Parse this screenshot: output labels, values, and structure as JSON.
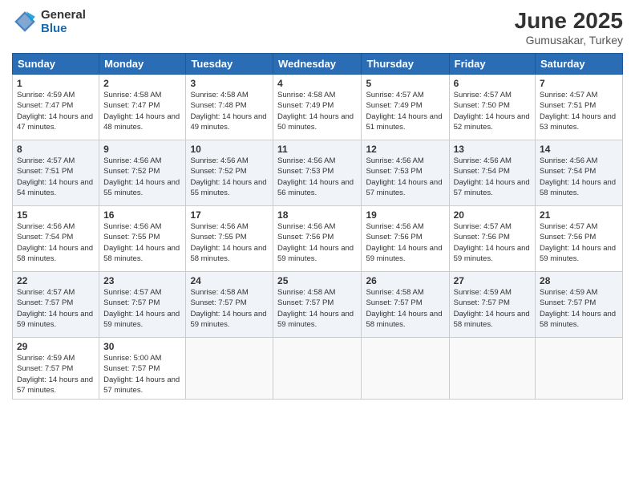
{
  "header": {
    "logo_line1": "General",
    "logo_line2": "Blue",
    "title": "June 2025",
    "location": "Gumusakar, Turkey"
  },
  "weekdays": [
    "Sunday",
    "Monday",
    "Tuesday",
    "Wednesday",
    "Thursday",
    "Friday",
    "Saturday"
  ],
  "weeks": [
    [
      {
        "day": "1",
        "sunrise": "4:59 AM",
        "sunset": "7:47 PM",
        "daylight": "14 hours and 47 minutes."
      },
      {
        "day": "2",
        "sunrise": "4:58 AM",
        "sunset": "7:47 PM",
        "daylight": "14 hours and 48 minutes."
      },
      {
        "day": "3",
        "sunrise": "4:58 AM",
        "sunset": "7:48 PM",
        "daylight": "14 hours and 49 minutes."
      },
      {
        "day": "4",
        "sunrise": "4:58 AM",
        "sunset": "7:49 PM",
        "daylight": "14 hours and 50 minutes."
      },
      {
        "day": "5",
        "sunrise": "4:57 AM",
        "sunset": "7:49 PM",
        "daylight": "14 hours and 51 minutes."
      },
      {
        "day": "6",
        "sunrise": "4:57 AM",
        "sunset": "7:50 PM",
        "daylight": "14 hours and 52 minutes."
      },
      {
        "day": "7",
        "sunrise": "4:57 AM",
        "sunset": "7:51 PM",
        "daylight": "14 hours and 53 minutes."
      }
    ],
    [
      {
        "day": "8",
        "sunrise": "4:57 AM",
        "sunset": "7:51 PM",
        "daylight": "14 hours and 54 minutes."
      },
      {
        "day": "9",
        "sunrise": "4:56 AM",
        "sunset": "7:52 PM",
        "daylight": "14 hours and 55 minutes."
      },
      {
        "day": "10",
        "sunrise": "4:56 AM",
        "sunset": "7:52 PM",
        "daylight": "14 hours and 55 minutes."
      },
      {
        "day": "11",
        "sunrise": "4:56 AM",
        "sunset": "7:53 PM",
        "daylight": "14 hours and 56 minutes."
      },
      {
        "day": "12",
        "sunrise": "4:56 AM",
        "sunset": "7:53 PM",
        "daylight": "14 hours and 57 minutes."
      },
      {
        "day": "13",
        "sunrise": "4:56 AM",
        "sunset": "7:54 PM",
        "daylight": "14 hours and 57 minutes."
      },
      {
        "day": "14",
        "sunrise": "4:56 AM",
        "sunset": "7:54 PM",
        "daylight": "14 hours and 58 minutes."
      }
    ],
    [
      {
        "day": "15",
        "sunrise": "4:56 AM",
        "sunset": "7:54 PM",
        "daylight": "14 hours and 58 minutes."
      },
      {
        "day": "16",
        "sunrise": "4:56 AM",
        "sunset": "7:55 PM",
        "daylight": "14 hours and 58 minutes."
      },
      {
        "day": "17",
        "sunrise": "4:56 AM",
        "sunset": "7:55 PM",
        "daylight": "14 hours and 58 minutes."
      },
      {
        "day": "18",
        "sunrise": "4:56 AM",
        "sunset": "7:56 PM",
        "daylight": "14 hours and 59 minutes."
      },
      {
        "day": "19",
        "sunrise": "4:56 AM",
        "sunset": "7:56 PM",
        "daylight": "14 hours and 59 minutes."
      },
      {
        "day": "20",
        "sunrise": "4:57 AM",
        "sunset": "7:56 PM",
        "daylight": "14 hours and 59 minutes."
      },
      {
        "day": "21",
        "sunrise": "4:57 AM",
        "sunset": "7:56 PM",
        "daylight": "14 hours and 59 minutes."
      }
    ],
    [
      {
        "day": "22",
        "sunrise": "4:57 AM",
        "sunset": "7:57 PM",
        "daylight": "14 hours and 59 minutes."
      },
      {
        "day": "23",
        "sunrise": "4:57 AM",
        "sunset": "7:57 PM",
        "daylight": "14 hours and 59 minutes."
      },
      {
        "day": "24",
        "sunrise": "4:58 AM",
        "sunset": "7:57 PM",
        "daylight": "14 hours and 59 minutes."
      },
      {
        "day": "25",
        "sunrise": "4:58 AM",
        "sunset": "7:57 PM",
        "daylight": "14 hours and 59 minutes."
      },
      {
        "day": "26",
        "sunrise": "4:58 AM",
        "sunset": "7:57 PM",
        "daylight": "14 hours and 58 minutes."
      },
      {
        "day": "27",
        "sunrise": "4:59 AM",
        "sunset": "7:57 PM",
        "daylight": "14 hours and 58 minutes."
      },
      {
        "day": "28",
        "sunrise": "4:59 AM",
        "sunset": "7:57 PM",
        "daylight": "14 hours and 58 minutes."
      }
    ],
    [
      {
        "day": "29",
        "sunrise": "4:59 AM",
        "sunset": "7:57 PM",
        "daylight": "14 hours and 57 minutes."
      },
      {
        "day": "30",
        "sunrise": "5:00 AM",
        "sunset": "7:57 PM",
        "daylight": "14 hours and 57 minutes."
      },
      null,
      null,
      null,
      null,
      null
    ]
  ]
}
